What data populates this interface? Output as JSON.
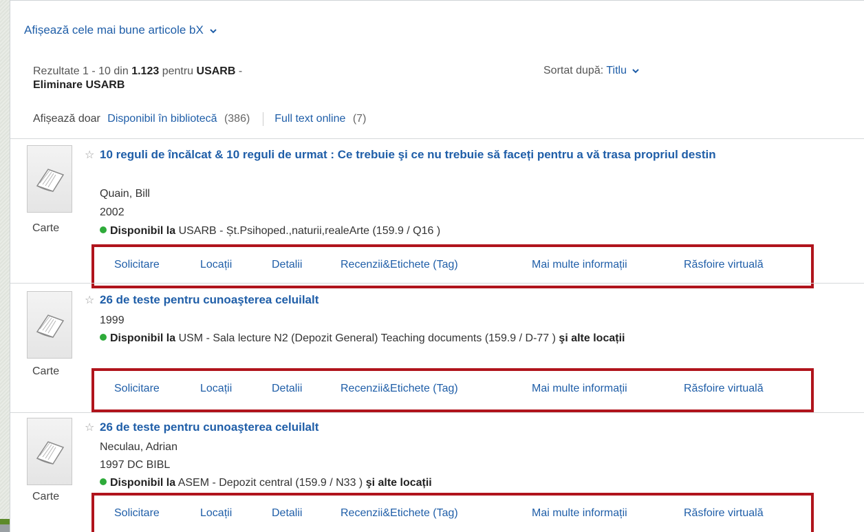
{
  "top_link": "Afișează cele mai bune articole bX",
  "summary": {
    "prefix": "Rezultate 1 - 10 din ",
    "total": "1.123",
    "for_text": "  pentru ",
    "query": "USARB",
    "dash": " -",
    "remove": "Eliminare USARB"
  },
  "sort": {
    "label": "Sortat după: ",
    "value": "Titlu"
  },
  "facets": {
    "label": "Afișează doar",
    "items": [
      {
        "label": "Disponibil în bibliotecă",
        "count": "(386)"
      },
      {
        "label": "Full text online",
        "count": "(7)"
      }
    ]
  },
  "actions": [
    "Solicitare",
    "Locații",
    "Detalii",
    "Recenzii&Etichete (Tag)",
    "Mai multe informații",
    "Răsfoire virtuală"
  ],
  "records": [
    {
      "type": "Carte",
      "title": "10 reguli de încălcat & 10 reguli de urmat : Ce trebuie şi ce nu trebuie să faceți pentru a vă trasa propriul destin",
      "author": "Quain, Bill",
      "year": "2002",
      "avail_label": "Disponibil la",
      "avail_text": " USARB - Șt.Psihoped.,naturii,realeArte  (159.9 / Q16 )",
      "avail_more": ""
    },
    {
      "type": "Carte",
      "title": "26 de teste pentru cunoaşterea celuilalt",
      "author": "",
      "year": "1999",
      "avail_label": "Disponibil la",
      "avail_text": " USM - Sala lecture N2 (Depozit General) Teaching documents (159.9 / D-77 ) ",
      "avail_more": "şi alte locații"
    },
    {
      "type": "Carte",
      "title": "26 de teste pentru cunoaşterea celuilalt",
      "author": "Neculau, Adrian",
      "year": "1997 DC BIBL",
      "avail_label": "Disponibil la",
      "avail_text": " ASEM - Depozit central   (159.9 / N33 ) ",
      "avail_more": "şi alte locații"
    }
  ]
}
